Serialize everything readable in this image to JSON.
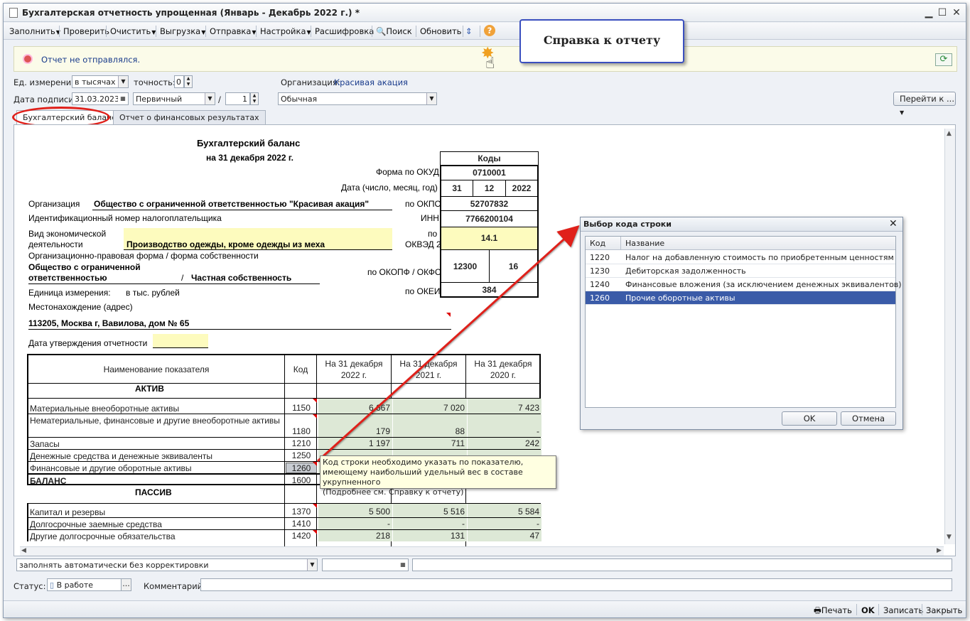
{
  "window": {
    "title": "Бухгалтерская отчетность упрощенная (Январь - Декабрь 2022 г.) *"
  },
  "toolbar": {
    "fill": "Заполнить",
    "check": "Проверить",
    "clear": "Очистить",
    "export": "Выгрузка",
    "send": "Отправка",
    "settings": "Настройка",
    "decode": "Расшифровка",
    "search": "Поиск",
    "refresh": "Обновить"
  },
  "callout": "Справка к отчету",
  "info": {
    "text": "Отчет не отправлялся."
  },
  "form": {
    "unit_label": "Ед. измерения:",
    "unit_value": "в тысячах р",
    "precision_label": "точность:",
    "precision_value": "0",
    "org_label": "Организация:",
    "org_value": "Красивая акация",
    "sign_date_label": "Дата подписи:",
    "sign_date_value": "31.03.2023",
    "doc_type_value": "Первичный",
    "slash": "/",
    "corr_value": "1",
    "kind_value": "Обычная",
    "goto_label": "Перейти к ..."
  },
  "tabs": [
    "Бухгалтерский баланс",
    "Отчет о финансовых результатах"
  ],
  "report": {
    "title": "Бухгалтерский баланс",
    "subtitle": "на 31 декабря 2022 г.",
    "codes_header": "Коды",
    "okud_label": "Форма по ОКУД",
    "okud_value": "0710001",
    "date_label": "Дата (число, месяц, год)",
    "date_d": "31",
    "date_m": "12",
    "date_y": "2022",
    "org_label": "Организация",
    "org_value": "Общество с ограниченной ответственностью \"Красивая акация\"",
    "okpo_label": "по ОКПО",
    "okpo_value": "52707832",
    "inn_label": "Идентификационный номер налогоплательщика",
    "inn_short": "ИНН",
    "inn_value": "7766200104",
    "activity_label_1": "Вид экономической",
    "activity_label_2": "деятельности",
    "activity_value": "Производство одежды, кроме одежды из меха",
    "okved_label_1": "по",
    "okved_label_2": "ОКВЭД 2",
    "okved_value": "14.1",
    "opf_label": "Организационно-правовая форма / форма собственности",
    "opf_value_1": "Общество с ограниченной",
    "opf_value_2": "ответственностью",
    "opf_slash": "/",
    "ownership_value": "Частная собственность",
    "okopf_label": "по ОКОПФ / ОКФС",
    "okopf_value": "12300",
    "okfs_value": "16",
    "unit_label": "Единица измерения:",
    "unit_value": "в тыс. рублей",
    "okei_label": "по ОКЕИ",
    "okei_value": "384",
    "address_label": "Местонахождение (адрес)",
    "address_value": "113205, Москва г, Вавилова, дом № 65",
    "approval_label": "Дата утверждения отчетности"
  },
  "table": {
    "col_name": "Наименование показателя",
    "col_code": "Код",
    "col_2022": "На 31 декабря 2022 г.",
    "col_2021": "На 31 декабря 2021 г.",
    "col_2020": "На 31 декабря 2020 г.",
    "section_assets": "АКТИВ",
    "section_liab": "ПАССИВ",
    "rows": [
      {
        "name": "Материальные внеоборотные активы",
        "code": "1150",
        "v2022": "6 667",
        "v2021": "7 020",
        "v2020": "7 423"
      },
      {
        "name": "Нематериальные, финансовые и другие внеоборотные активы",
        "code": "1180",
        "v2022": "179",
        "v2021": "88",
        "v2020": "-"
      },
      {
        "name": "Запасы",
        "code": "1210",
        "v2022": "1 197",
        "v2021": "711",
        "v2020": "242"
      },
      {
        "name": "Денежные средства и денежные эквиваленты",
        "code": "1250",
        "v2022": "",
        "v2021": "",
        "v2020": ""
      },
      {
        "name": "Финансовые и другие оборотные активы",
        "code": "1260",
        "v2022": "",
        "v2021": "",
        "v2020": ""
      },
      {
        "name": "БАЛАНС",
        "code": "1600",
        "v2022": "",
        "v2021": "",
        "v2020": ""
      },
      {
        "name": "Капитал и резервы",
        "code": "1370",
        "v2022": "5 500",
        "v2021": "5 516",
        "v2020": "5 584"
      },
      {
        "name": "Долгосрочные заемные средства",
        "code": "1410",
        "v2022": "-",
        "v2021": "-",
        "v2020": "-"
      },
      {
        "name": "Другие долгосрочные обязательства",
        "code": "1420",
        "v2022": "218",
        "v2021": "131",
        "v2020": "47"
      }
    ]
  },
  "tooltip": {
    "line1": "Код строки необходимо указать по показателю,",
    "line2": "имеющему наибольший удельный вес в составе укрупненного",
    "line3": "(Подробнее см. Справку к отчету)"
  },
  "dialog": {
    "title": "Выбор кода строки",
    "col_code": "Код",
    "col_name": "Название",
    "rows": [
      {
        "code": "1220",
        "name": "Налог на добавленную стоимость по приобретенным ценностям"
      },
      {
        "code": "1230",
        "name": "Дебиторская задолженность"
      },
      {
        "code": "1240",
        "name": "Финансовые вложения (за исключением денежных эквивалентов)"
      },
      {
        "code": "1260",
        "name": "Прочие оборотные активы"
      }
    ],
    "ok": "OK",
    "cancel": "Отмена"
  },
  "bottom": {
    "fill_mode": "заполнять автоматически без корректировки",
    "status_label": "Статус:",
    "status_value": "В работе",
    "comment_label": "Комментарий:"
  },
  "statusbar": {
    "print": "Печать",
    "ok": "OK",
    "save": "Записать",
    "close": "Закрыть"
  }
}
